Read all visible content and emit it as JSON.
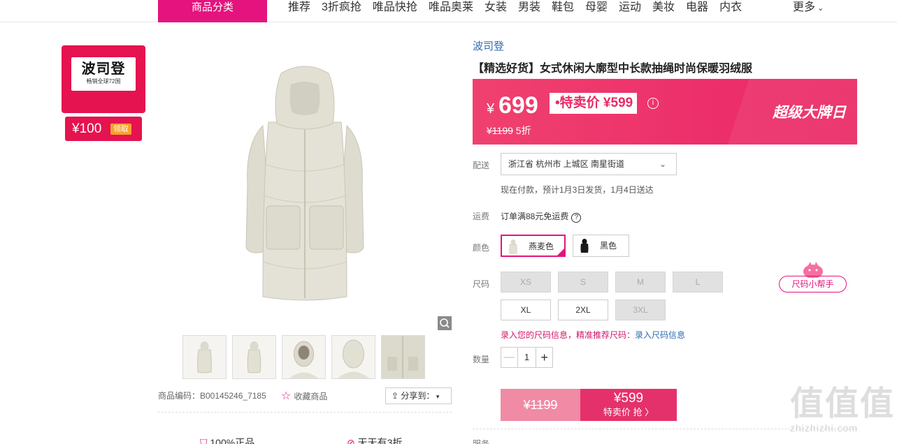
{
  "nav": {
    "category_label": "商品分类",
    "items": [
      "推荐",
      "3折疯抢",
      "唯品快抢",
      "唯品奥莱",
      "女装",
      "男装",
      "鞋包",
      "母婴",
      "运动",
      "美妆",
      "电器",
      "内衣"
    ],
    "more_label": "更多"
  },
  "brand_card": {
    "brand_name": "波司登",
    "slogan": "畅销全球72国",
    "coupon_amount": "¥100",
    "coupon_action": "领取"
  },
  "gallery": {
    "sku_code": "商品编码：B00145246_7185",
    "favorite_label": "收藏商品",
    "share_label": "分享到：",
    "features": [
      "100%正品",
      "天天有3折"
    ]
  },
  "product": {
    "brand_link": "波司登",
    "title": "【精选好货】女式休闲大廓型中长款抽绳时尚保暖羽绒服",
    "price_yen": "¥",
    "price": "699",
    "special_price": "•特卖价 ¥599",
    "info_symbol": "i",
    "original_price": "¥1199",
    "discount": "5折",
    "event_label": "超级大牌日",
    "accent_color": "#e4137d",
    "banner_color": "#ea2a66"
  },
  "delivery": {
    "label": "配送",
    "address": "浙江省 杭州市 上城区 南星街道",
    "eta": "现在付款，预计1月3日发货，1月4日送达"
  },
  "shipping": {
    "label": "运费",
    "text": "订单满88元免运费",
    "help_symbol": "?"
  },
  "color": {
    "label": "颜色",
    "options": [
      {
        "name": "燕麦色",
        "selected": true
      },
      {
        "name": "黑色",
        "selected": false
      }
    ]
  },
  "size": {
    "label": "尺码",
    "options": [
      {
        "name": "XS",
        "available": false
      },
      {
        "name": "S",
        "available": false
      },
      {
        "name": "M",
        "available": false
      },
      {
        "name": "L",
        "available": false
      },
      {
        "name": "XL",
        "available": true
      },
      {
        "name": "2XL",
        "available": true
      },
      {
        "name": "3XL",
        "available": false
      }
    ],
    "helper_label": "尺码小帮手",
    "note_text": "录入您的尺码信息，精准推荐尺码：",
    "note_link": "录入尺码信息"
  },
  "quantity": {
    "label": "数量",
    "value": "1",
    "minus": "—",
    "plus": "+"
  },
  "buy": {
    "original_price": "¥1199",
    "price": "¥599",
    "action": "特卖价 抢 〉"
  },
  "services_label": "服务",
  "watermark": {
    "big": "值值值",
    "small": "zhizhizhi.com"
  }
}
